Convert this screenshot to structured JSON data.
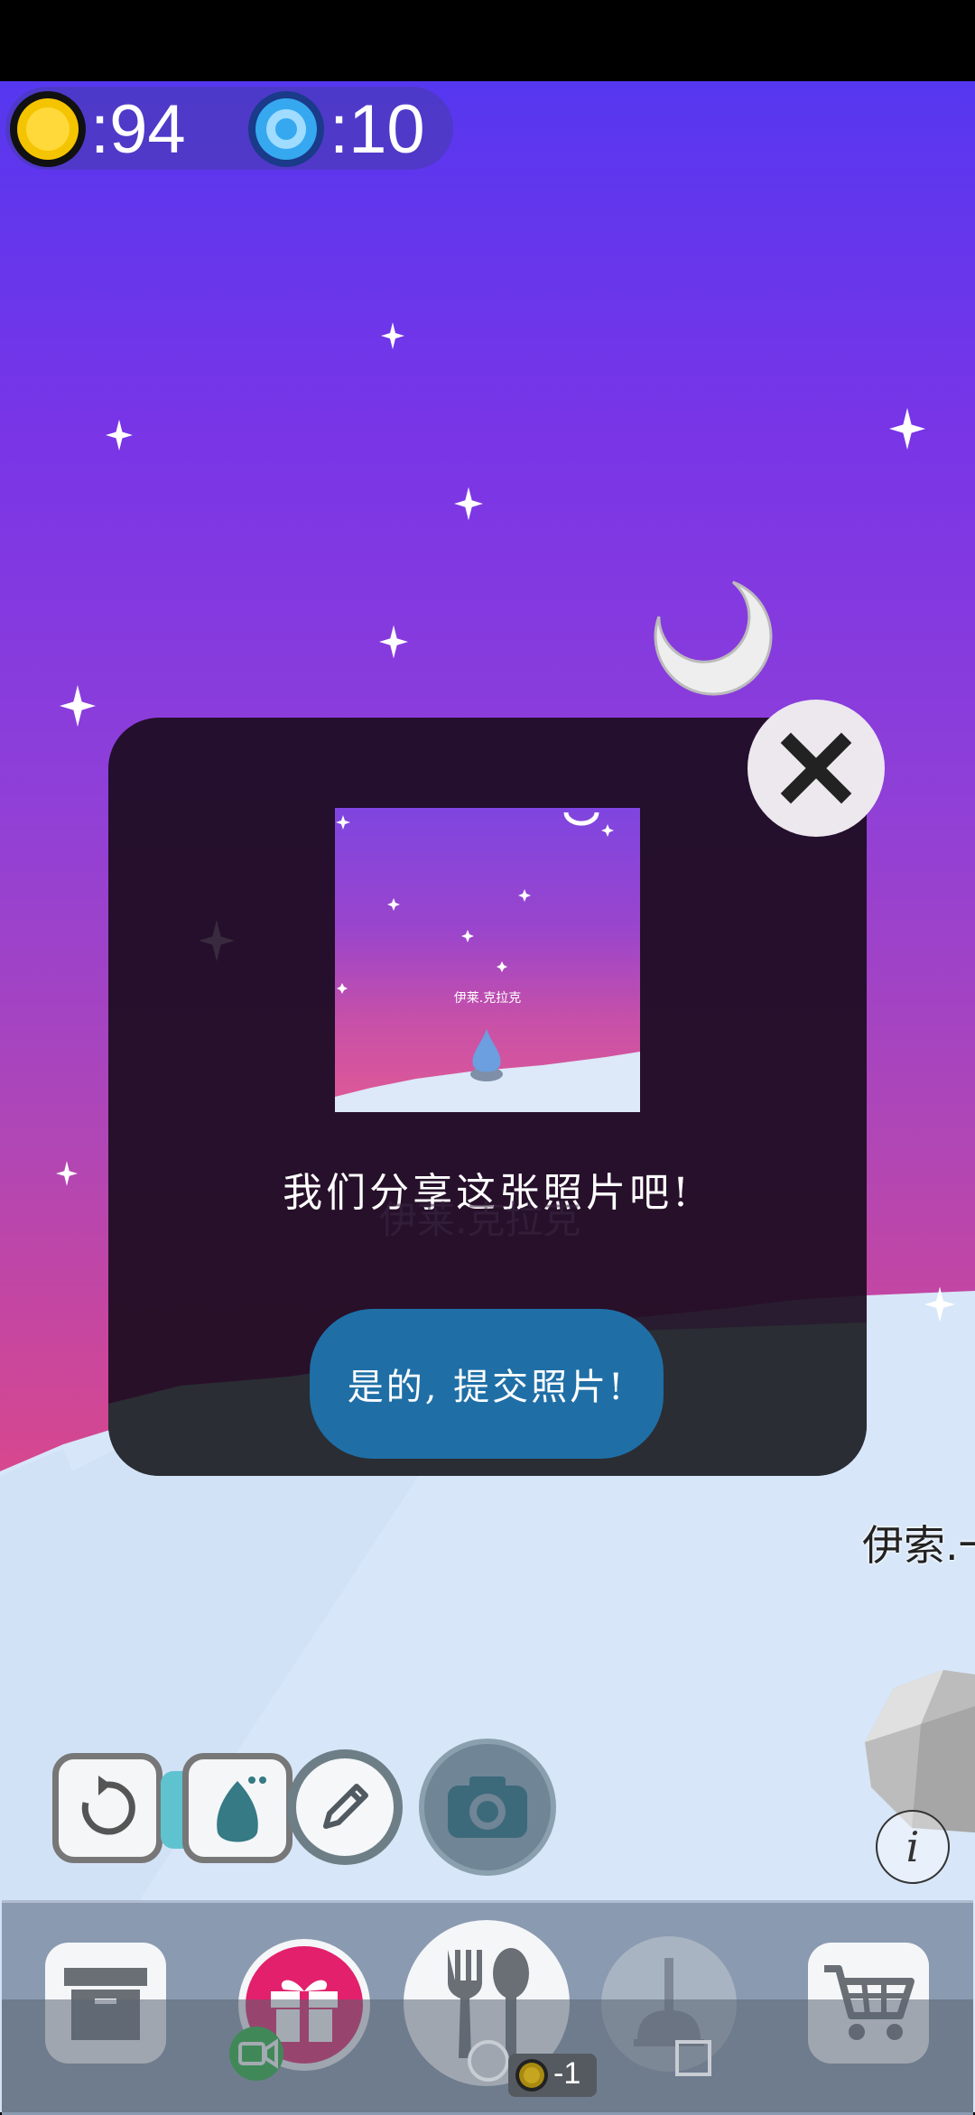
{
  "currency": {
    "gold": ":94",
    "gems": ":10"
  },
  "dialog": {
    "photo_caption": "伊莱.克拉克",
    "prompt": "我们分享这张照片吧!",
    "ghost_name": "伊莱.克拉克",
    "submit_label": "是的, 提交照片!"
  },
  "world": {
    "player_name": "伊索.一"
  },
  "toolbar": {
    "info_label": "i"
  },
  "bottom_nav": {
    "cost": "-1"
  },
  "colors": {
    "sky_top": "#5637f0",
    "sky_bottom": "#e05a8a",
    "snow": "#d7e6f8",
    "submit_button": "#1f6fa6",
    "gift_button": "#e2206c"
  }
}
